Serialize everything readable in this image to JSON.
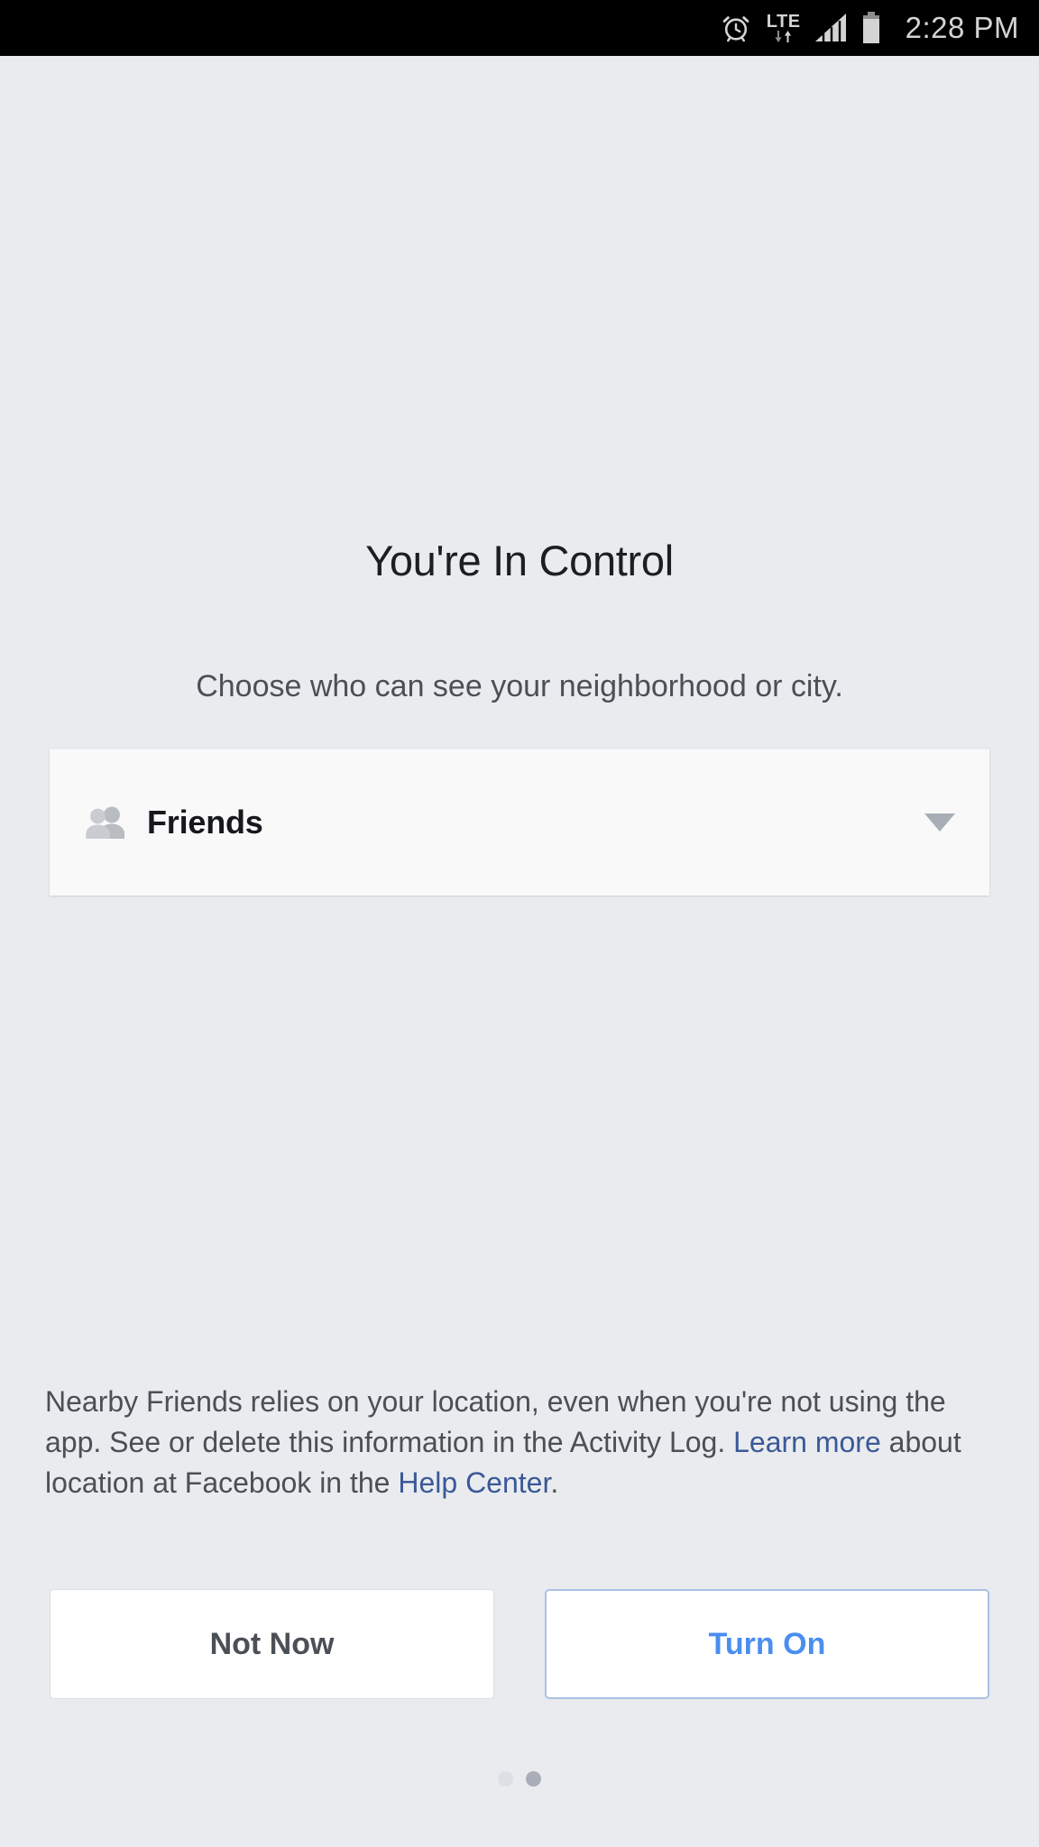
{
  "status_bar": {
    "time": "2:28 PM",
    "network_type": "LTE",
    "icons": [
      "alarm-clock-icon",
      "lte-data-icon",
      "signal-bars-icon",
      "battery-icon"
    ],
    "background": "#000000",
    "foreground": "#d4d4d4"
  },
  "screen": {
    "background": "#e9ebee",
    "headline": "You're In Control",
    "subhead": "Choose who can see your neighborhood or city."
  },
  "audience_selector": {
    "icon": "friends-icon",
    "selected_value": "Friends",
    "caret": "chevron-down-icon",
    "background": "#f9f9fa"
  },
  "disclosure": {
    "part1": "Nearby Friends relies on your location, even when you're not using the app. See or delete this information in the Activity Log. ",
    "link1": "Learn more",
    "part2": " about location at Facebook in the ",
    "link2": "Help Center",
    "part3": ".",
    "link_color": "#3b5998"
  },
  "buttons": {
    "secondary_label": "Not Now",
    "primary_label": "Turn On",
    "primary_color": "#4a8ef0"
  },
  "pagination": {
    "total": 2,
    "active_index": 2,
    "active_color": "#a9aeb8",
    "inactive_color": "#dcdfe3"
  }
}
